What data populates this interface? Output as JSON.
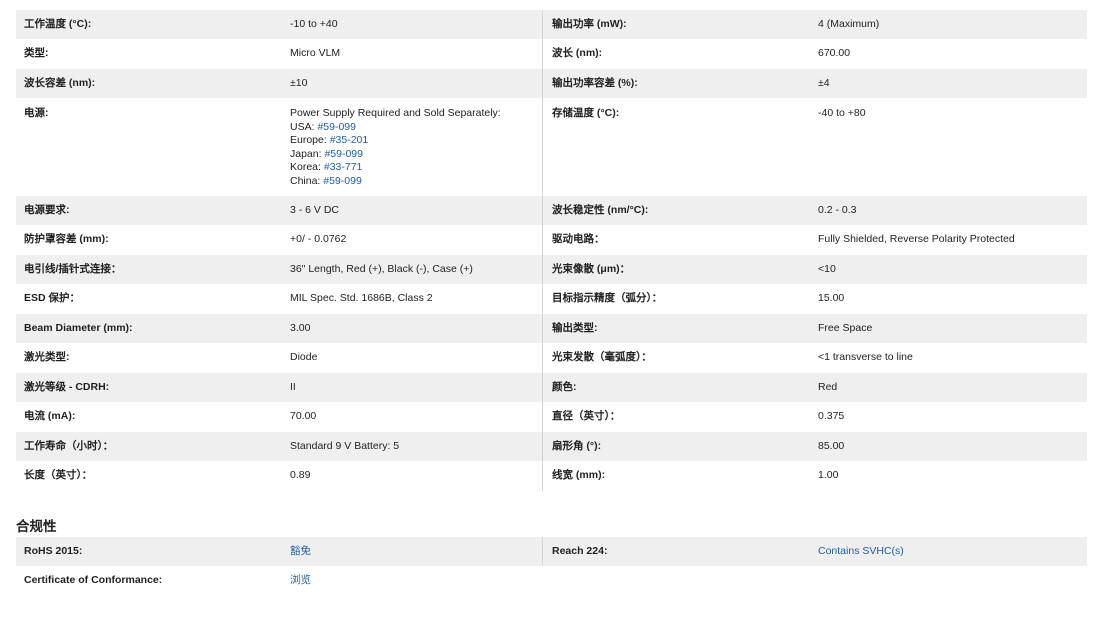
{
  "specs": {
    "rows": [
      {
        "l1": "工作温度 (°C):",
        "v1": "-10 to +40",
        "l2": "输出功率 (mW):",
        "v2": "4 (Maximum)"
      },
      {
        "l1": "类型:",
        "v1": "Micro VLM",
        "l2": "波长 (nm):",
        "v2": "670.00"
      },
      {
        "l1": "波长容差 (nm):",
        "v1": "±10",
        "l2": "输出功率容差 (%):",
        "v2": "±4"
      },
      {
        "l1": "电源:",
        "v1_text": "Power Supply Required and Sold Separately:",
        "power_options": [
          {
            "region": "USA: ",
            "part": "#59-099"
          },
          {
            "region": "Europe: ",
            "part": "#35-201"
          },
          {
            "region": "Japan: ",
            "part": "#59-099"
          },
          {
            "region": "Korea: ",
            "part": "#33-771"
          },
          {
            "region": "China: ",
            "part": "#59-099"
          }
        ],
        "l2": "存储温度 (°C):",
        "v2": "-40 to +80"
      },
      {
        "l1": "电源要求:",
        "v1": "3 - 6 V DC",
        "l2": "波长稳定性 (nm/°C):",
        "v2": "0.2 - 0.3"
      },
      {
        "l1": "防护罩容差 (mm):",
        "v1": "+0/ - 0.0762",
        "l2": "驱动电路：",
        "v2": "Fully Shielded, Reverse Polarity Protected"
      },
      {
        "l1": "电引线/插针式连接：",
        "v1": "36\" Length, Red (+), Black (-), Case (+)",
        "l2": "光束像散 (μm)：",
        "v2": "<10"
      },
      {
        "l1": "ESD 保护：",
        "v1": "MIL Spec. Std. 1686B, Class 2",
        "l2": "目标指示精度（弧分）：",
        "v2": "15.00"
      },
      {
        "l1": "Beam Diameter (mm):",
        "v1": "3.00",
        "l2": "输出类型:",
        "v2": "Free Space"
      },
      {
        "l1": "激光类型:",
        "v1": "Diode",
        "l2": "光束发散（毫弧度）：",
        "v2": "<1 transverse to line"
      },
      {
        "l1": "激光等级 - CDRH:",
        "v1": "II",
        "l2": "颜色:",
        "v2": "Red"
      },
      {
        "l1": "电流 (mA):",
        "v1": "70.00",
        "l2": "直径（英寸）：",
        "v2": "0.375"
      },
      {
        "l1": "工作寿命（小时）：",
        "v1": "Standard 9 V Battery: 5",
        "l2": "扇形角 (°):",
        "v2": "85.00"
      },
      {
        "l1": "长度（英寸）：",
        "v1": "0.89",
        "l2": "线宽 (mm):",
        "v2": "1.00"
      }
    ]
  },
  "compliance": {
    "title": "合规性",
    "rows": [
      {
        "l1": "RoHS 2015:",
        "v1": "豁免",
        "l2": "Reach 224:",
        "v2": "Contains SVHC(s)"
      },
      {
        "l1": "Certificate of Conformance:",
        "v1": "浏览",
        "l2": "",
        "v2": ""
      }
    ]
  }
}
